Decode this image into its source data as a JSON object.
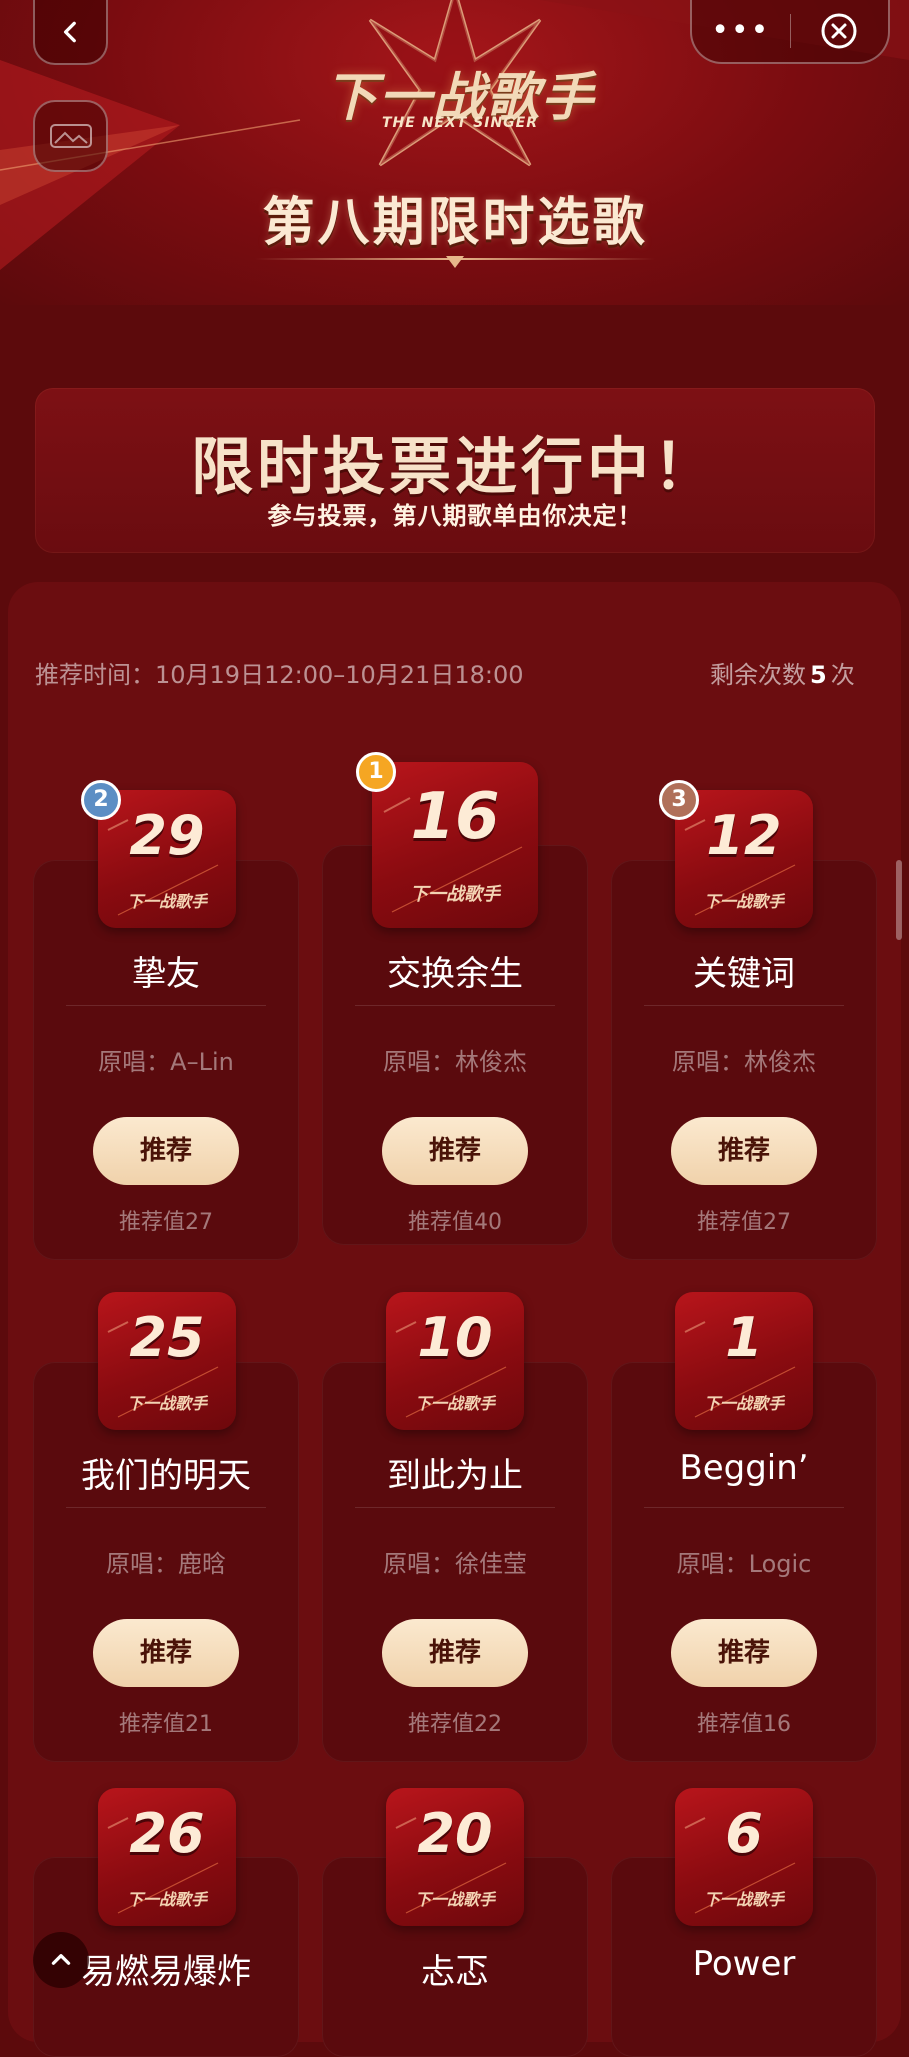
{
  "colors": {
    "primary_red": "#a5161a",
    "bg": "#5c0a0c",
    "button_gold": "#f0d2ab",
    "rank1": "#f5a623",
    "rank2": "#5c8ec4",
    "rank3": "#b0705a"
  },
  "header": {
    "back_icon": "chevron-left-icon",
    "more_label": "•••",
    "close_icon": "close-circle-icon",
    "logo_text": "下一战歌手",
    "logo_sub": "THE NEXT SINGER",
    "episode_title": "第八期限时选歌"
  },
  "banner": {
    "title": "限时投票进行中！",
    "subtitle": "参与投票，第八期歌单由你决定！"
  },
  "meta": {
    "time": "推荐时间：10月19日12:00–10月21日18:00",
    "remaining_prefix": "剩余次数",
    "remaining_count": "5",
    "remaining_suffix": "次"
  },
  "logo_small": "下一战歌手",
  "songs": [
    {
      "number": "29",
      "rank": "2",
      "title": "挚友",
      "original": "原唱：A–Lin",
      "button": "推荐",
      "value": "推荐值27"
    },
    {
      "number": "16",
      "rank": "1",
      "title": "交换余生",
      "original": "原唱：林俊杰",
      "button": "推荐",
      "value": "推荐值40"
    },
    {
      "number": "12",
      "rank": "3",
      "title": "关键词",
      "original": "原唱：林俊杰",
      "button": "推荐",
      "value": "推荐值27"
    },
    {
      "number": "25",
      "title": "我们的明天",
      "original": "原唱：鹿晗",
      "button": "推荐",
      "value": "推荐值21"
    },
    {
      "number": "10",
      "title": "到此为止",
      "original": "原唱：徐佳莹",
      "button": "推荐",
      "value": "推荐值22"
    },
    {
      "number": "1",
      "title": "Beggin’",
      "original": "原唱：Logic",
      "button": "推荐",
      "value": "推荐值16"
    },
    {
      "number": "26",
      "title": "易燃易爆炸"
    },
    {
      "number": "20",
      "title": "忐忑"
    },
    {
      "number": "6",
      "title": "Power"
    }
  ]
}
